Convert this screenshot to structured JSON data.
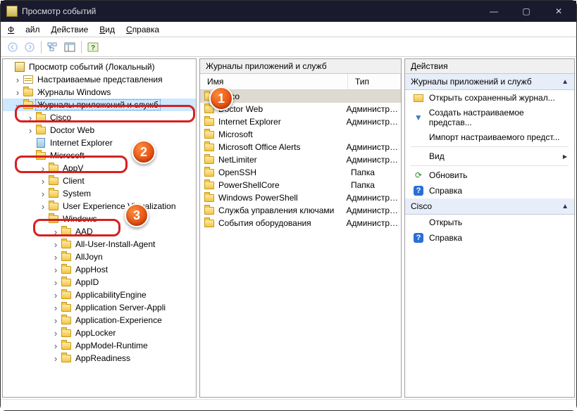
{
  "title": "Просмотр событий",
  "menu": {
    "file": "Файл",
    "action": "Действие",
    "view": "Вид",
    "help": "Справка"
  },
  "tree": {
    "root": "Просмотр событий (Локальный)",
    "customViews": "Настраиваемые представления",
    "winLogs": "Журналы Windows",
    "appServices": "Журналы приложений и служб",
    "nodes": {
      "cisco": "Cisco",
      "doctorWeb": "Doctor Web",
      "ie": "Internet Explorer",
      "microsoft": "Microsoft",
      "appv": "AppV",
      "client": "Client",
      "system": "System",
      "uev": "User Experience Virtualization",
      "windows": "Windows",
      "aad": "AAD",
      "allUserInstall": "All-User-Install-Agent",
      "alljoyn": "AllJoyn",
      "appHost": "AppHost",
      "appId": "AppID",
      "applicabilityEngine": "ApplicabilityEngine",
      "appServerApp": "Application Server-Appli",
      "appExperience": "Application-Experience",
      "appLocker": "AppLocker",
      "appModelRuntime": "AppModel-Runtime",
      "appReadiness": "AppReadiness"
    }
  },
  "mid": {
    "header": "Журналы приложений и служб",
    "colName": "Имя",
    "colType": "Тип",
    "rows": [
      {
        "name": "Cisco",
        "type": "",
        "sel": true
      },
      {
        "name": "Doctor Web",
        "type": "Администр…"
      },
      {
        "name": "Internet Explorer",
        "type": "Администр…"
      },
      {
        "name": "Microsoft",
        "type": ""
      },
      {
        "name": "Microsoft Office Alerts",
        "type": "Администр…"
      },
      {
        "name": "NetLimiter",
        "type": "Администр…"
      },
      {
        "name": "OpenSSH",
        "type": "Папка"
      },
      {
        "name": "PowerShellCore",
        "type": "Папка"
      },
      {
        "name": "Windows PowerShell",
        "type": "Администр…"
      },
      {
        "name": "Служба управления ключами",
        "type": "Администр…"
      },
      {
        "name": "События оборудования",
        "type": "Администр…"
      }
    ]
  },
  "actions": {
    "header": "Действия",
    "group1": "Журналы приложений и служб",
    "openSaved": "Открыть сохраненный журнал...",
    "createCustom": "Создать настраиваемое представ...",
    "importCustom": "Импорт настраиваемого предст...",
    "view": "Вид",
    "refresh": "Обновить",
    "help": "Справка",
    "group2": "Cisco",
    "open": "Открыть",
    "help2": "Справка"
  }
}
